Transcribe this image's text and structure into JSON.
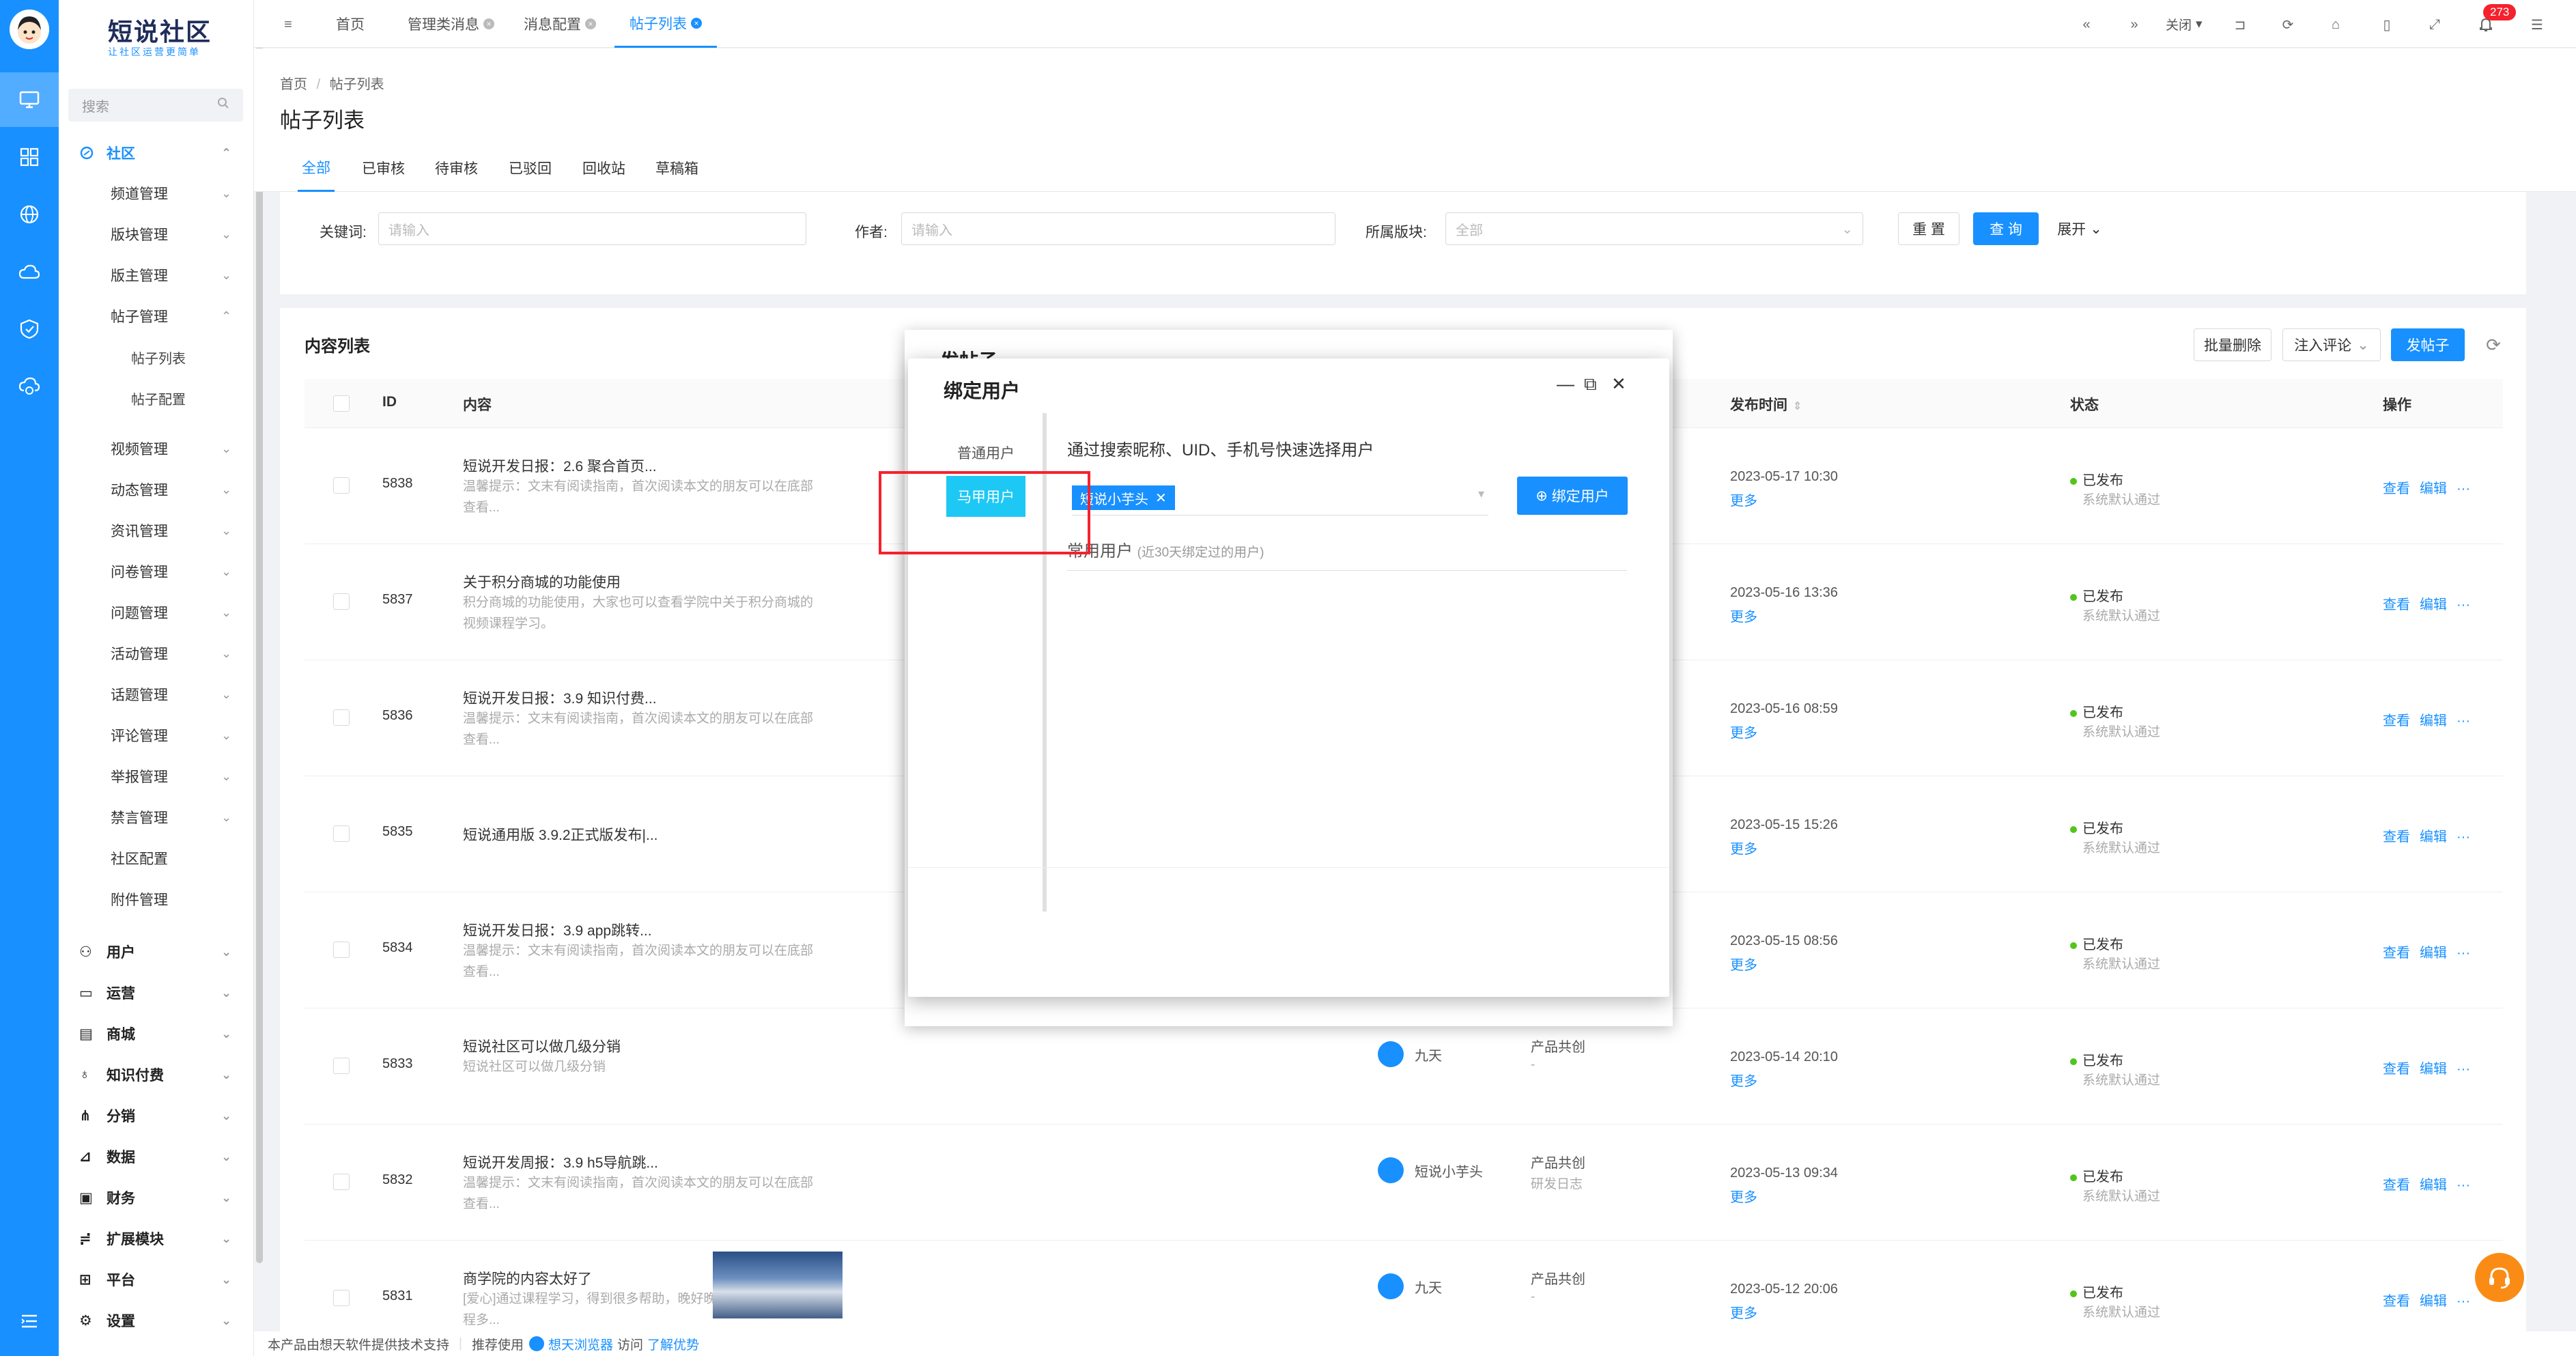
{
  "app": {
    "logo_title": "短说社区",
    "logo_subtitle": "让社区运营更简单"
  },
  "sidebar": {
    "search_placeholder": "搜索",
    "section_community": "社区",
    "items": [
      {
        "label": "频道管理"
      },
      {
        "label": "版块管理"
      },
      {
        "label": "版主管理"
      },
      {
        "label": "帖子管理"
      },
      {
        "label": "帖子列表"
      },
      {
        "label": "帖子配置"
      },
      {
        "label": "视频管理"
      },
      {
        "label": "动态管理"
      },
      {
        "label": "资讯管理"
      },
      {
        "label": "问卷管理"
      },
      {
        "label": "问题管理"
      },
      {
        "label": "活动管理"
      },
      {
        "label": "话题管理"
      },
      {
        "label": "评论管理"
      },
      {
        "label": "举报管理"
      },
      {
        "label": "禁言管理"
      },
      {
        "label": "社区配置"
      },
      {
        "label": "附件管理"
      }
    ],
    "top_items": [
      {
        "label": "用户"
      },
      {
        "label": "运营"
      },
      {
        "label": "商城"
      },
      {
        "label": "知识付费"
      },
      {
        "label": "分销"
      },
      {
        "label": "数据"
      },
      {
        "label": "财务"
      },
      {
        "label": "扩展模块"
      },
      {
        "label": "平台"
      },
      {
        "label": "设置"
      }
    ]
  },
  "topbar": {
    "tabs": [
      {
        "label": "首页"
      },
      {
        "label": "管理类消息"
      },
      {
        "label": "消息配置"
      },
      {
        "label": "帖子列表"
      }
    ],
    "close_label": "关闭",
    "notification_count": "273"
  },
  "page": {
    "breadcrumb_home": "首页",
    "breadcrumb_sep": "/",
    "breadcrumb_current": "帖子列表",
    "title": "帖子列表",
    "subtabs": [
      {
        "label": "全部"
      },
      {
        "label": "已审核"
      },
      {
        "label": "待审核"
      },
      {
        "label": "已驳回"
      },
      {
        "label": "回收站"
      },
      {
        "label": "草稿箱"
      }
    ]
  },
  "filters": {
    "keyword_label": "关键词:",
    "keyword_placeholder": "请输入",
    "author_label": "作者:",
    "author_placeholder": "请输入",
    "block_label": "所属版块:",
    "block_value": "全部",
    "reset_label": "重 置",
    "query_label": "查 询",
    "expand_label": "展开"
  },
  "content": {
    "section_title": "内容列表",
    "batch_delete": "批量删除",
    "inject_comment": "注入评论",
    "new_post": "发帖子",
    "columns": {
      "id": "ID",
      "content": "内容",
      "publish_time": "发布时间",
      "status": "状态",
      "ops": "操作"
    },
    "rows": [
      {
        "id": "5838",
        "title": "短说开发日报：2.6 聚合首页...",
        "desc": "温馨提示：文末有阅读指南，首次阅读本文的朋友可以在底部查看...",
        "date": "2023-05-17 10:30",
        "author": "",
        "block": "",
        "block_sub": ""
      },
      {
        "id": "5837",
        "title": "关于积分商城的功能使用",
        "desc": "积分商城的功能使用，大家也可以查看学院中关于积分商城的视频课程学习。",
        "date": "2023-05-16 13:36",
        "author": "",
        "block": "",
        "block_sub": ""
      },
      {
        "id": "5836",
        "title": "短说开发日报：3.9 知识付费...",
        "desc": "温馨提示：文末有阅读指南，首次阅读本文的朋友可以在底部查看...",
        "date": "2023-05-16 08:59",
        "author": "",
        "block": "",
        "block_sub": ""
      },
      {
        "id": "5835",
        "title": "短说通用版 3.9.2正式版发布|...",
        "desc": "",
        "date": "2023-05-15 15:26",
        "author": "",
        "block": "",
        "block_sub": ""
      },
      {
        "id": "5834",
        "title": "短说开发日报：3.9 app跳转...",
        "desc": "温馨提示：文末有阅读指南，首次阅读本文的朋友可以在底部查看...",
        "date": "2023-05-15 08:56",
        "author": "",
        "block": "",
        "block_sub": ""
      },
      {
        "id": "5833",
        "title": "短说社区可以做几级分销",
        "desc": "短说社区可以做几级分销",
        "date": "2023-05-14 20:10",
        "author": "九天",
        "block": "产品共创",
        "block_sub": "-"
      },
      {
        "id": "5832",
        "title": "短说开发周报：3.9 h5导航跳...",
        "desc": "温馨提示：文末有阅读指南，首次阅读本文的朋友可以在底部查看...",
        "date": "2023-05-13 09:34",
        "author": "短说小芋头",
        "block": "产品共创",
        "block_sub": "研发日志"
      },
      {
        "id": "5831",
        "title": "商学院的内容太好了",
        "desc": "[爱心]通过课程学习，得到很多帮助，晚好晚好晚好，希望课程多...",
        "date": "2023-05-12 20:06",
        "author": "九天",
        "block": "产品共创",
        "block_sub": "-"
      }
    ],
    "status_label": "已发布",
    "status_sub": "系统默认通过",
    "more_label": "更多",
    "view_label": "查看",
    "edit_label": "编辑",
    "ellipsis": "···"
  },
  "back_dialog": {
    "title": "发帖子"
  },
  "bind_dialog": {
    "title": "绑定用户",
    "tab_normal": "普通用户",
    "tab_vest": "马甲用户",
    "hint": "通过搜索昵称、UID、手机号快速选择用户",
    "selected_tag": "短说小芋头",
    "bind_button": "绑定用户",
    "common_users": "常用用户",
    "common_users_note": "(近30天绑定过的用户)"
  },
  "footer": {
    "support_text": "本产品由想天软件提供技术支持",
    "recommend": "推荐使用",
    "browser": "想天浏览器",
    "visit": "访问",
    "learn_more": "了解优势"
  },
  "colors": {
    "primary": "#1890ff",
    "vest_tab": "#1ec8f5",
    "success": "#52c41a",
    "danger": "#f5222d",
    "help": "#fa8c16"
  }
}
